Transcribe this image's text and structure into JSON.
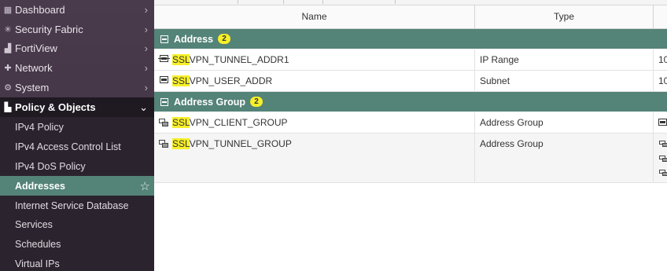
{
  "sidebar": {
    "items": [
      {
        "label": "Dashboard",
        "icon": "dashboard-icon",
        "glyph": "▦"
      },
      {
        "label": "Security Fabric",
        "icon": "security-fabric-icon",
        "glyph": "✳"
      },
      {
        "label": "FortiView",
        "icon": "fortiview-icon",
        "glyph": "▟"
      },
      {
        "label": "Network",
        "icon": "network-icon",
        "glyph": "✚"
      },
      {
        "label": "System",
        "icon": "gear-icon",
        "glyph": "⚙"
      },
      {
        "label": "Policy & Objects",
        "icon": "policy-objects-icon",
        "glyph": "▙"
      }
    ],
    "chevron_right": "›",
    "chevron_down": "⌄",
    "subitems": [
      {
        "label": "IPv4 Policy"
      },
      {
        "label": "IPv4 Access Control List"
      },
      {
        "label": "IPv4 DoS Policy"
      },
      {
        "label": "Addresses"
      },
      {
        "label": "Internet Service Database"
      },
      {
        "label": "Services"
      },
      {
        "label": "Schedules"
      },
      {
        "label": "Virtual IPs"
      }
    ],
    "favorite_glyph": "☆"
  },
  "table": {
    "columns": [
      "Name",
      "Type"
    ],
    "groups": [
      {
        "title": "Address",
        "count": "2",
        "rows": [
          {
            "highlight": "SSL",
            "name_rest": "VPN_TUNNEL_ADDR1",
            "type": "IP Range",
            "extra": "10"
          },
          {
            "highlight": "SSL",
            "name_rest": "VPN_USER_ADDR",
            "type": "Subnet",
            "extra": "10"
          }
        ]
      },
      {
        "title": "Address Group",
        "count": "2",
        "rows": [
          {
            "highlight": "SSL",
            "name_rest": "VPN_CLIENT_GROUP",
            "type": "Address Group"
          },
          {
            "highlight": "SSL",
            "name_rest": "VPN_TUNNEL_GROUP",
            "type": "Address Group"
          }
        ]
      }
    ]
  },
  "colors": {
    "sidebar_bg": "#4a3b4c",
    "sidebar_active": "#1f1922",
    "accent": "#548378",
    "highlight": "#f6ef2a"
  }
}
